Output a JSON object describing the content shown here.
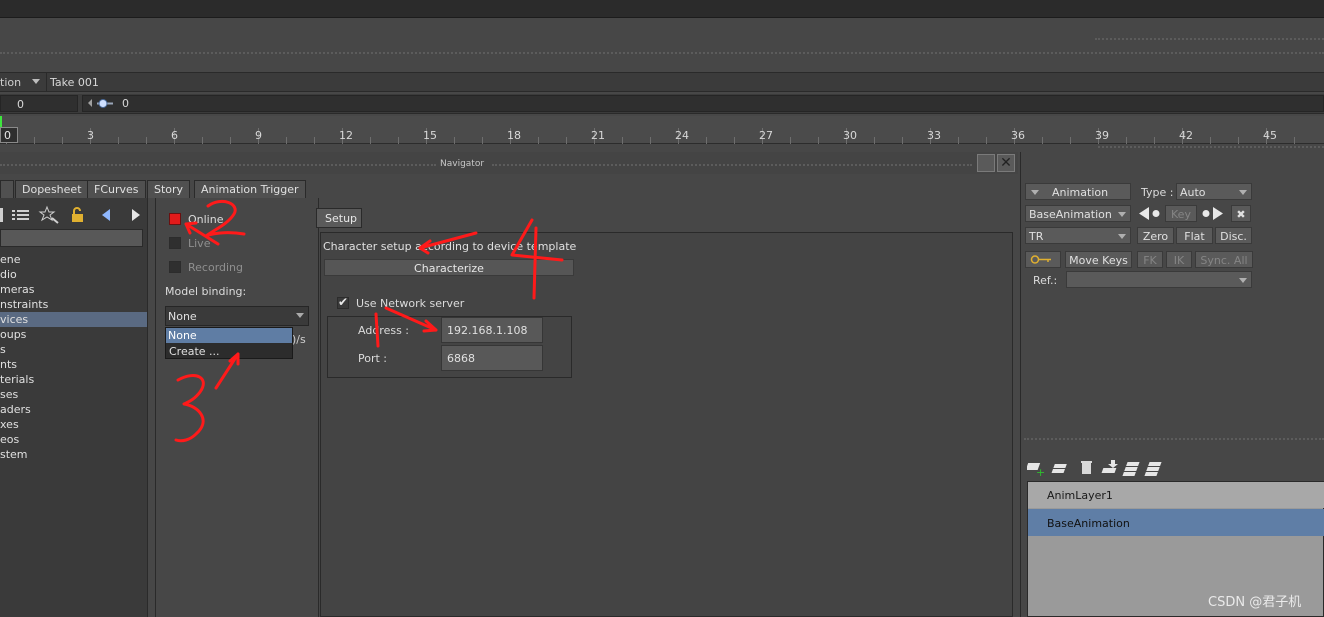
{
  "transport": {
    "take_mode": "tion",
    "take_name": "Take 001",
    "start_frame": "0",
    "slider_value": "0",
    "current_frame": "0"
  },
  "timeline": {
    "tick_labels": [
      "3",
      "6",
      "9",
      "12",
      "15",
      "18",
      "21",
      "24",
      "27",
      "30",
      "33",
      "36",
      "39",
      "42",
      "45"
    ]
  },
  "navigator": {
    "title": "Navigator",
    "tabs": [
      "Dopesheet",
      "FCurves",
      "Story",
      "Animation Trigger"
    ],
    "tree_items": [
      "ene",
      "dio",
      "meras",
      "nstraints",
      "vices",
      "oups",
      "s",
      "nts",
      "terials",
      "ses",
      "aders",
      "xes",
      "eos",
      "stem"
    ],
    "selected_item": "vices"
  },
  "device": {
    "online_label": "Online",
    "live_label": "Live",
    "recording_label": "Recording",
    "model_binding_label": "Model binding:",
    "binding_value": "None",
    "binding_options": [
      "None",
      "Create ..."
    ],
    "fps_fragment": ")/s"
  },
  "setup": {
    "tab_label": "Setup",
    "description": "Character setup according to device template",
    "characterize_label": "Characterize",
    "use_network_label": "Use Network server",
    "use_network_checked": true,
    "address_label": "Address :",
    "address_value": "192.168.1.108",
    "port_label": "Port :",
    "port_value": "6868"
  },
  "animation_panel": {
    "animation_dropdown": "Animation",
    "type_label": "Type :",
    "type_value": "Auto",
    "layer_dropdown": "BaseAnimation",
    "key_label": "Key",
    "channel_dropdown": "TR",
    "zero_label": "Zero",
    "flat_label": "Flat",
    "disc_label": "Disc.",
    "move_keys_label": "Move Keys",
    "fk_label": "FK",
    "ik_label": "IK",
    "sync_label": "Sync. All",
    "ref_label": "Ref.:",
    "layers": [
      "AnimLayer1",
      "BaseAnimation"
    ],
    "selected_layer": "BaseAnimation"
  },
  "watermark": "CSDN @君子机",
  "colors": {
    "online_led": "#e21a1a",
    "selection": "#5f7da4",
    "annotation": "#ff1a1a"
  }
}
